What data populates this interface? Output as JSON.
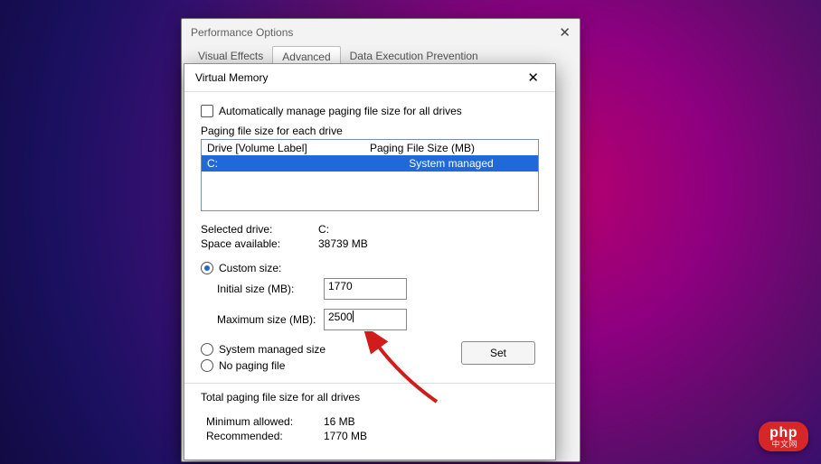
{
  "perfOptions": {
    "title": "Performance Options",
    "close": "✕",
    "tabs": {
      "visual": "Visual Effects",
      "advanced": "Advanced",
      "dep": "Data Execution Prevention"
    }
  },
  "vm": {
    "title": "Virtual Memory",
    "close": "✕",
    "autoManage": "Automatically manage paging file size for all drives",
    "groupLabel": "Paging file size for each drive",
    "driveHeaders": {
      "left": "Drive  [Volume Label]",
      "right": "Paging File Size (MB)"
    },
    "drive": {
      "letter": "C:",
      "status": "System managed"
    },
    "selectedDriveLabel": "Selected drive:",
    "selectedDriveValue": "C:",
    "spaceLabel": "Space available:",
    "spaceValue": "38739 MB",
    "radios": {
      "custom": "Custom size:",
      "system": "System managed size",
      "nopage": "No paging file"
    },
    "initialLabel": "Initial size (MB):",
    "initialValue": "1770",
    "maxLabel": "Maximum size (MB):",
    "maxValue": "2500",
    "setButton": "Set",
    "totalLabel": "Total paging file size for all drives",
    "minAllowedLabel": "Minimum allowed:",
    "minAllowedValue": "16 MB",
    "recommendedLabel": "Recommended:",
    "recommendedValue": "1770 MB"
  },
  "branding": {
    "logoMain": "php",
    "logoSub": "中文网"
  }
}
